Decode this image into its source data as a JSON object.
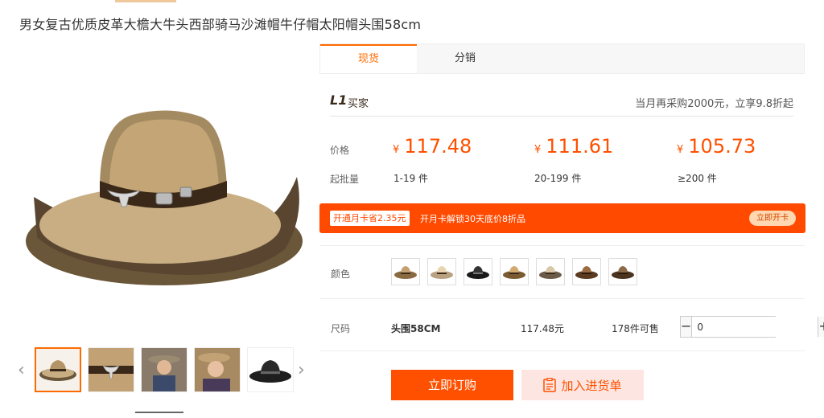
{
  "product": {
    "title": "男女复古优质皮革大檐大牛头西部骑马沙滩帽牛仔帽太阳帽头围58cm"
  },
  "gallery": {
    "main_image": "cowboy-hat-image",
    "thumbnails": [
      "hat-thumb",
      "hat-band-thumb",
      "man-photo-thumb",
      "man-photo-thumb",
      "black-hat-thumb"
    ],
    "prev_icon": "‹",
    "next_icon": "›"
  },
  "tabs": [
    {
      "label": "现货",
      "active": true
    },
    {
      "label": "分销",
      "active": false
    }
  ],
  "buyer": {
    "level": "L1",
    "label": "买家",
    "promo": "当月再采购2000元，立享9.8折起"
  },
  "pricing": {
    "price_label": "价格",
    "batch_label": "起批量",
    "currency": "¥",
    "tiers": [
      {
        "price": "117.48",
        "qty": "1-19 件"
      },
      {
        "price": "111.61",
        "qty": "20-199 件"
      },
      {
        "price": "105.73",
        "qty": "≥200 件"
      }
    ]
  },
  "card_banner": {
    "tag": "开通月卡省2.35元",
    "text": "开月卡解锁30天底价8折品",
    "button": "立即开卡"
  },
  "color": {
    "label": "颜色",
    "options": [
      "tan-hat",
      "cream-hat",
      "black-hat",
      "beige-hat",
      "light-hat",
      "brown-hat",
      "dark-brown-hat"
    ]
  },
  "size": {
    "label": "尺码",
    "name": "头围58CM",
    "price": "117.48元",
    "stock": "178件可售",
    "quantity": "0",
    "minus": "−",
    "plus": "+"
  },
  "actions": {
    "buy": "立即订购",
    "add_to_list": "加入进货单"
  },
  "colors": {
    "accent": "#ff5000",
    "banner": "#ff4a00"
  }
}
